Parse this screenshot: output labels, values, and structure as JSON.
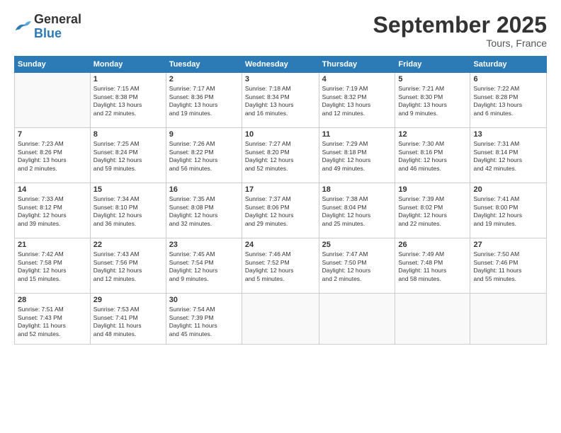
{
  "logo": {
    "text_general": "General",
    "text_blue": "Blue"
  },
  "header": {
    "month_year": "September 2025",
    "location": "Tours, France"
  },
  "days_of_week": [
    "Sunday",
    "Monday",
    "Tuesday",
    "Wednesday",
    "Thursday",
    "Friday",
    "Saturday"
  ],
  "weeks": [
    [
      {
        "day": "",
        "info": ""
      },
      {
        "day": "1",
        "info": "Sunrise: 7:15 AM\nSunset: 8:38 PM\nDaylight: 13 hours\nand 22 minutes."
      },
      {
        "day": "2",
        "info": "Sunrise: 7:17 AM\nSunset: 8:36 PM\nDaylight: 13 hours\nand 19 minutes."
      },
      {
        "day": "3",
        "info": "Sunrise: 7:18 AM\nSunset: 8:34 PM\nDaylight: 13 hours\nand 16 minutes."
      },
      {
        "day": "4",
        "info": "Sunrise: 7:19 AM\nSunset: 8:32 PM\nDaylight: 13 hours\nand 12 minutes."
      },
      {
        "day": "5",
        "info": "Sunrise: 7:21 AM\nSunset: 8:30 PM\nDaylight: 13 hours\nand 9 minutes."
      },
      {
        "day": "6",
        "info": "Sunrise: 7:22 AM\nSunset: 8:28 PM\nDaylight: 13 hours\nand 6 minutes."
      }
    ],
    [
      {
        "day": "7",
        "info": "Sunrise: 7:23 AM\nSunset: 8:26 PM\nDaylight: 13 hours\nand 2 minutes."
      },
      {
        "day": "8",
        "info": "Sunrise: 7:25 AM\nSunset: 8:24 PM\nDaylight: 12 hours\nand 59 minutes."
      },
      {
        "day": "9",
        "info": "Sunrise: 7:26 AM\nSunset: 8:22 PM\nDaylight: 12 hours\nand 56 minutes."
      },
      {
        "day": "10",
        "info": "Sunrise: 7:27 AM\nSunset: 8:20 PM\nDaylight: 12 hours\nand 52 minutes."
      },
      {
        "day": "11",
        "info": "Sunrise: 7:29 AM\nSunset: 8:18 PM\nDaylight: 12 hours\nand 49 minutes."
      },
      {
        "day": "12",
        "info": "Sunrise: 7:30 AM\nSunset: 8:16 PM\nDaylight: 12 hours\nand 46 minutes."
      },
      {
        "day": "13",
        "info": "Sunrise: 7:31 AM\nSunset: 8:14 PM\nDaylight: 12 hours\nand 42 minutes."
      }
    ],
    [
      {
        "day": "14",
        "info": "Sunrise: 7:33 AM\nSunset: 8:12 PM\nDaylight: 12 hours\nand 39 minutes."
      },
      {
        "day": "15",
        "info": "Sunrise: 7:34 AM\nSunset: 8:10 PM\nDaylight: 12 hours\nand 36 minutes."
      },
      {
        "day": "16",
        "info": "Sunrise: 7:35 AM\nSunset: 8:08 PM\nDaylight: 12 hours\nand 32 minutes."
      },
      {
        "day": "17",
        "info": "Sunrise: 7:37 AM\nSunset: 8:06 PM\nDaylight: 12 hours\nand 29 minutes."
      },
      {
        "day": "18",
        "info": "Sunrise: 7:38 AM\nSunset: 8:04 PM\nDaylight: 12 hours\nand 25 minutes."
      },
      {
        "day": "19",
        "info": "Sunrise: 7:39 AM\nSunset: 8:02 PM\nDaylight: 12 hours\nand 22 minutes."
      },
      {
        "day": "20",
        "info": "Sunrise: 7:41 AM\nSunset: 8:00 PM\nDaylight: 12 hours\nand 19 minutes."
      }
    ],
    [
      {
        "day": "21",
        "info": "Sunrise: 7:42 AM\nSunset: 7:58 PM\nDaylight: 12 hours\nand 15 minutes."
      },
      {
        "day": "22",
        "info": "Sunrise: 7:43 AM\nSunset: 7:56 PM\nDaylight: 12 hours\nand 12 minutes."
      },
      {
        "day": "23",
        "info": "Sunrise: 7:45 AM\nSunset: 7:54 PM\nDaylight: 12 hours\nand 9 minutes."
      },
      {
        "day": "24",
        "info": "Sunrise: 7:46 AM\nSunset: 7:52 PM\nDaylight: 12 hours\nand 5 minutes."
      },
      {
        "day": "25",
        "info": "Sunrise: 7:47 AM\nSunset: 7:50 PM\nDaylight: 12 hours\nand 2 minutes."
      },
      {
        "day": "26",
        "info": "Sunrise: 7:49 AM\nSunset: 7:48 PM\nDaylight: 11 hours\nand 58 minutes."
      },
      {
        "day": "27",
        "info": "Sunrise: 7:50 AM\nSunset: 7:46 PM\nDaylight: 11 hours\nand 55 minutes."
      }
    ],
    [
      {
        "day": "28",
        "info": "Sunrise: 7:51 AM\nSunset: 7:43 PM\nDaylight: 11 hours\nand 52 minutes."
      },
      {
        "day": "29",
        "info": "Sunrise: 7:53 AM\nSunset: 7:41 PM\nDaylight: 11 hours\nand 48 minutes."
      },
      {
        "day": "30",
        "info": "Sunrise: 7:54 AM\nSunset: 7:39 PM\nDaylight: 11 hours\nand 45 minutes."
      },
      {
        "day": "",
        "info": ""
      },
      {
        "day": "",
        "info": ""
      },
      {
        "day": "",
        "info": ""
      },
      {
        "day": "",
        "info": ""
      }
    ]
  ]
}
